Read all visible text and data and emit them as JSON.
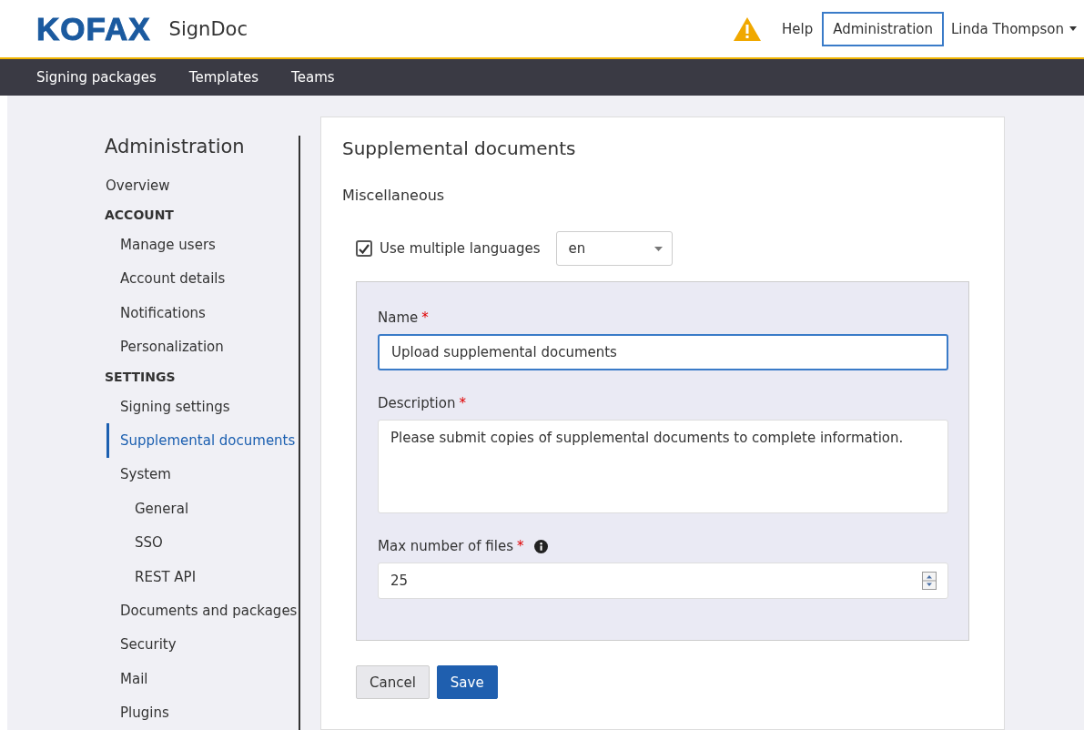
{
  "header": {
    "logo": "KOFAX",
    "product": "SignDoc",
    "help": "Help",
    "admin_button": "Administration",
    "user": "Linda Thompson"
  },
  "nav": [
    {
      "label": "Signing packages",
      "selected": false
    },
    {
      "label": "Templates",
      "selected": false
    },
    {
      "label": "Teams",
      "selected": false
    }
  ],
  "sidebar": {
    "title": "Administration",
    "items": [
      {
        "kind": "link",
        "label": "Overview",
        "selected": false
      },
      {
        "kind": "heading",
        "label": "ACCOUNT",
        "children": [
          {
            "kind": "link",
            "label": "Manage users",
            "selected": false
          },
          {
            "kind": "link",
            "label": "Account details",
            "selected": false
          },
          {
            "kind": "link",
            "label": "Notifications",
            "selected": false
          },
          {
            "kind": "link",
            "label": "Personalization",
            "selected": false
          }
        ]
      },
      {
        "kind": "heading",
        "label": "SETTINGS",
        "children": [
          {
            "kind": "link",
            "label": "Signing settings",
            "selected": false
          },
          {
            "kind": "link",
            "label": "Supplemental documents",
            "selected": true
          },
          {
            "kind": "link",
            "label": "System",
            "selected": false,
            "children": [
              {
                "kind": "link",
                "label": "General",
                "selected": false
              },
              {
                "kind": "link",
                "label": "SSO",
                "selected": false
              },
              {
                "kind": "link",
                "label": "REST API",
                "selected": false
              }
            ]
          },
          {
            "kind": "link",
            "label": "Documents and packages",
            "selected": false
          },
          {
            "kind": "link",
            "label": "Security",
            "selected": false
          },
          {
            "kind": "link",
            "label": "Mail",
            "selected": false
          },
          {
            "kind": "link",
            "label": "Plugins",
            "selected": false
          }
        ]
      }
    ]
  },
  "main": {
    "title": "Supplemental documents",
    "section": "Miscellaneous",
    "multi_language": {
      "label": "Use multiple languages",
      "checked": true,
      "value": "en"
    },
    "fields": [
      {
        "kind": "text",
        "label": "Name",
        "required_mark": "*",
        "value": "Upload supplemental documents",
        "focused": true
      },
      {
        "kind": "textarea",
        "label": "Description",
        "required_mark": "*",
        "value": "Please submit copies of supplemental documents to complete information.",
        "focused": false
      },
      {
        "kind": "number",
        "label": "Max number of files",
        "required_mark": "*",
        "info": true,
        "value": "25",
        "focused": false
      }
    ],
    "buttons": [
      {
        "kind": "secondary",
        "label": "Cancel"
      },
      {
        "kind": "primary",
        "label": "Save"
      }
    ]
  }
}
